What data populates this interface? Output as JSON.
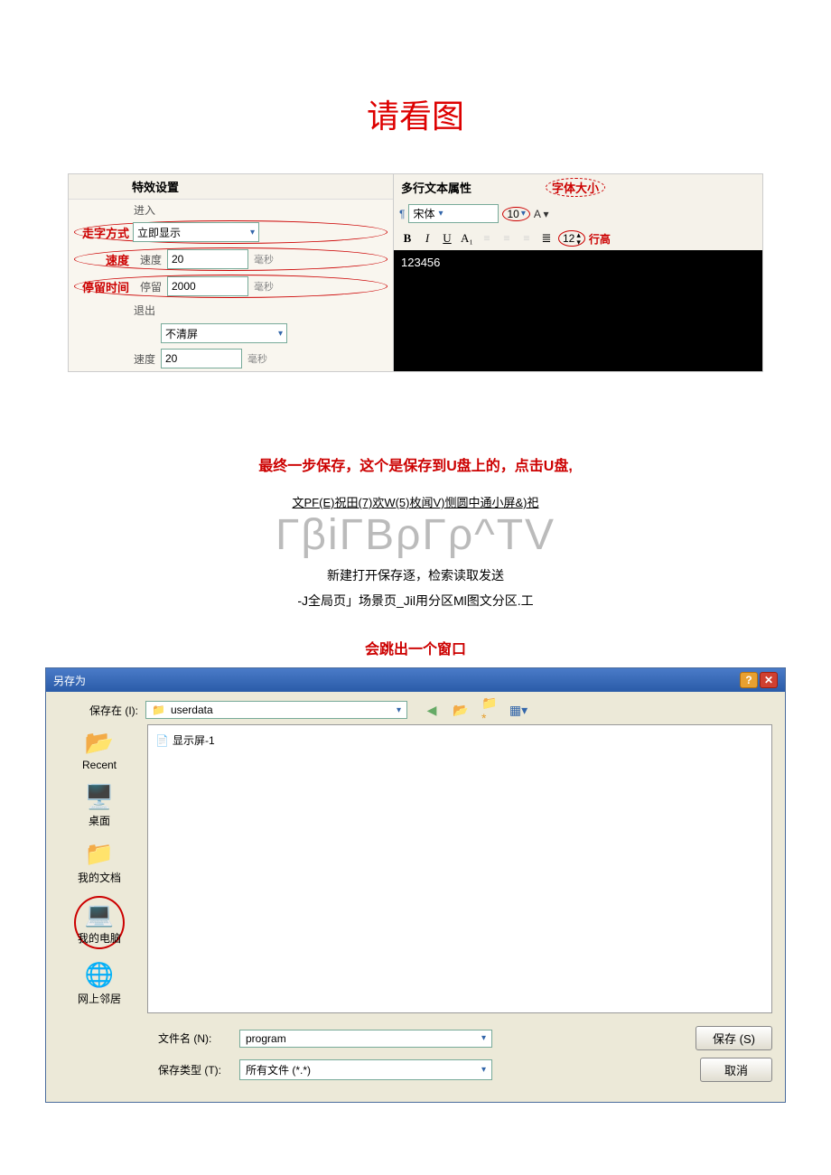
{
  "title_main": "请看图",
  "left_panel": {
    "header": "特效设置",
    "enter_label": "进入",
    "row_zzfs": {
      "red": "走字方式",
      "value": "立即显示"
    },
    "row_speed1": {
      "red": "速度",
      "sub": "速度",
      "value": "20",
      "unit": "毫秒"
    },
    "row_stay": {
      "red": "停留时间",
      "sub": "停留",
      "value": "2000",
      "unit": "毫秒"
    },
    "exit_label": "退出",
    "row_exit_sel": {
      "value": "不清屏"
    },
    "row_speed2": {
      "sub": "速度",
      "value": "20",
      "unit": "毫秒"
    }
  },
  "right_panel": {
    "header_left": "多行文本属性",
    "header_right": "字体大小",
    "font_sel": "宋体",
    "font_size": "10",
    "line_h_label": "行高",
    "line_h_val": "12",
    "tb": {
      "b": "B",
      "i": "I",
      "u": "U",
      "a": "A₁"
    },
    "preview_text": "123456"
  },
  "caption1": "最终一步保存，这个是保存到U盘上的，点击U盘,",
  "menu_text": "文PF(E)祝田(7)欢W(5)枚闻V)恻圆中通小屏&)祀",
  "big_text": "ΓβiΓΒρΓρ^TV",
  "sub_text1": "新建打开保存逐，检索读取发送",
  "sub_text2": "-J全局页」场景页_Jil用分区Ml图文分区.工",
  "caption2": "会跳出一个窗口",
  "dialog": {
    "title": "另存为",
    "save_in_label": "保存在 (I):",
    "save_in_value": "userdata",
    "sidebar": {
      "recent": "Recent",
      "desktop": "桌面",
      "docs": "我的文档",
      "mycomputer": "我的电脑",
      "network": "网上邻居"
    },
    "file_item": "显示屏-1",
    "filename_label": "文件名 (N):",
    "filename_value": "program",
    "filetype_label": "保存类型 (T):",
    "filetype_value": "所有文件 (*.*)",
    "btn_save": "保存 (S)",
    "btn_cancel": "取消"
  }
}
